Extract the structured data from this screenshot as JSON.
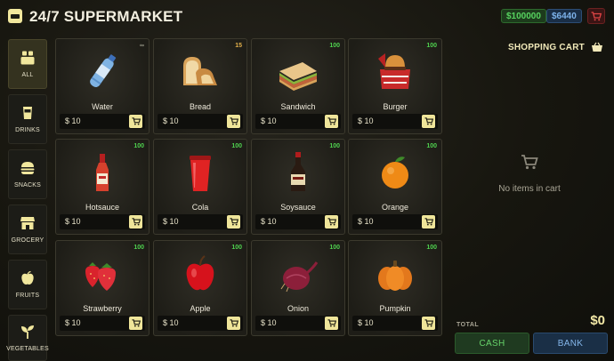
{
  "header": {
    "title": "24/7 SUPERMARKET",
    "cash_balance": "$100000",
    "bank_balance": "$6440"
  },
  "sidebar": {
    "items": [
      {
        "label": "ALL",
        "icon": "all-box-icon",
        "active": true
      },
      {
        "label": "DRINKS",
        "icon": "cup-icon",
        "active": false
      },
      {
        "label": "SNACKS",
        "icon": "burger-icon",
        "active": false
      },
      {
        "label": "GROCERY",
        "icon": "storefront-icon",
        "active": false
      },
      {
        "label": "FRUITS",
        "icon": "apple-icon",
        "active": false
      },
      {
        "label": "VEGETABLES",
        "icon": "sprout-icon",
        "active": false
      }
    ]
  },
  "products": [
    {
      "name": "Water",
      "price": "$ 10",
      "stock": "∞",
      "icon": "water-bottle-icon"
    },
    {
      "name": "Bread",
      "price": "$ 10",
      "stock": "15",
      "icon": "bread-icon"
    },
    {
      "name": "Sandwich",
      "price": "$ 10",
      "stock": "100",
      "icon": "sandwich-icon"
    },
    {
      "name": "Burger",
      "price": "$ 10",
      "stock": "100",
      "icon": "burger-box-icon"
    },
    {
      "name": "Hotsauce",
      "price": "$ 10",
      "stock": "100",
      "icon": "hotsauce-bottle-icon"
    },
    {
      "name": "Cola",
      "price": "$ 10",
      "stock": "100",
      "icon": "cola-cup-icon"
    },
    {
      "name": "Soysauce",
      "price": "$ 10",
      "stock": "100",
      "icon": "soysauce-bottle-icon"
    },
    {
      "name": "Orange",
      "price": "$ 10",
      "stock": "100",
      "icon": "orange-icon"
    },
    {
      "name": "Strawberry",
      "price": "$ 10",
      "stock": "100",
      "icon": "strawberry-icon"
    },
    {
      "name": "Apple",
      "price": "$ 10",
      "stock": "100",
      "icon": "apple-fruit-icon"
    },
    {
      "name": "Onion",
      "price": "$ 10",
      "stock": "100",
      "icon": "onion-icon"
    },
    {
      "name": "Pumpkin",
      "price": "$ 10",
      "stock": "100",
      "icon": "pumpkin-icon"
    }
  ],
  "cart": {
    "title": "SHOPPING CART",
    "empty_text": "No items in cart",
    "total_label": "TOTAL",
    "total_value": "$0",
    "cash_button": "CASH",
    "bank_button": "BANK"
  },
  "colors": {
    "accent": "#efe59a",
    "cash_green": "#57d35f",
    "bank_blue": "#7db2ea",
    "stock_green": "#4fd14f",
    "stock_low": "#e3b04b"
  }
}
